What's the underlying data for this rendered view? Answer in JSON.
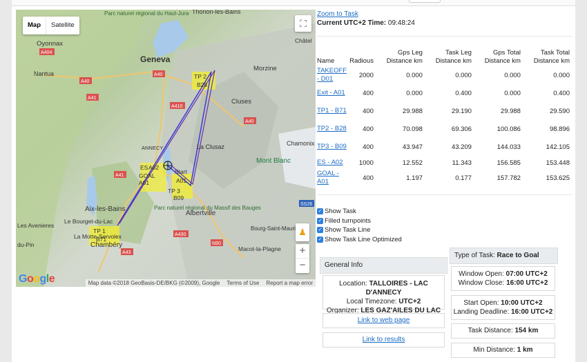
{
  "map": {
    "type_buttons": [
      "Map",
      "Satellite"
    ],
    "places": [
      {
        "name": "Geneva",
        "cls": "city"
      },
      {
        "name": "Oyonnax",
        "cls": "town"
      },
      {
        "name": "Nantua",
        "cls": "town"
      },
      {
        "name": "Morzine",
        "cls": "town"
      },
      {
        "name": "Cluses",
        "cls": "town"
      },
      {
        "name": "ANNECY",
        "cls": "small"
      },
      {
        "name": "La Clusaz",
        "cls": "town"
      },
      {
        "name": "Chamonix",
        "cls": "town"
      },
      {
        "name": "Mont Blanc",
        "cls": "mountain"
      },
      {
        "name": "Albertville",
        "cls": "town"
      },
      {
        "name": "Aix-les-Bains",
        "cls": "town"
      },
      {
        "name": "Chambéry",
        "cls": "town"
      },
      {
        "name": "Les Avenieres",
        "cls": "town"
      },
      {
        "name": "Le Bourget-du-Lac",
        "cls": "town"
      },
      {
        "name": "La Motte-Servolex",
        "cls": "town"
      },
      {
        "name": "Bourg-Saint-Maurice",
        "cls": "town"
      },
      {
        "name": "Macot-la-Plagne",
        "cls": "town"
      },
      {
        "name": "Thonon-les-Bains",
        "cls": "town"
      },
      {
        "name": "Parc naturel régional du Haut-Jura",
        "cls": "park"
      },
      {
        "name": "Parc naturel régional du Massif des Bauges",
        "cls": "park"
      },
      {
        "name": "Châtel",
        "cls": "town"
      },
      {
        "name": "du-Pin",
        "cls": "town"
      }
    ],
    "roads": [
      "A404",
      "A40",
      "A40",
      "A41",
      "A410",
      "A40",
      "A430",
      "N90",
      "A41",
      "A43",
      "SS26"
    ],
    "turnpoints": [
      {
        "label": "TP 2",
        "sub": "B28"
      },
      {
        "label": "TP 3",
        "sub": "B09"
      },
      {
        "label": "TP 1",
        "sub": "B71"
      },
      {
        "label": "ES",
        "sub": "A02"
      },
      {
        "label": "GOAL",
        "sub": "A01"
      },
      {
        "label": "Start",
        "sub": "A01"
      }
    ],
    "google_logo": "Google",
    "attribution": [
      "Map data ©2018 GeoBasis-DE/BKG (©2009), Google",
      "Terms of Use",
      "Report a map error"
    ]
  },
  "zoom_link": "Zoom to Task",
  "current_time_label": "Current UTC+2 Time:",
  "current_time": "09:48:24",
  "table": {
    "headers": [
      "Name",
      "Radious",
      "Gps Leg Distance km",
      "Task Leg Distance km",
      "Gps Total Distance km",
      "Task Total Distance km"
    ],
    "rows": [
      {
        "name": "TAKEOFF - D01",
        "radius": "2000",
        "gps_leg": "0.000",
        "task_leg": "0.000",
        "gps_total": "0.000",
        "task_total": "0.000"
      },
      {
        "name": "Exit - A01",
        "radius": "400",
        "gps_leg": "0.000",
        "task_leg": "0.400",
        "gps_total": "0.000",
        "task_total": "0.400"
      },
      {
        "name": "TP1 - B71",
        "radius": "400",
        "gps_leg": "29.988",
        "task_leg": "29.190",
        "gps_total": "29.988",
        "task_total": "29.590"
      },
      {
        "name": "TP2 - B28",
        "radius": "400",
        "gps_leg": "70.098",
        "task_leg": "69.306",
        "gps_total": "100.086",
        "task_total": "98.896"
      },
      {
        "name": "TP3 - B09",
        "radius": "400",
        "gps_leg": "43.947",
        "task_leg": "43.209",
        "gps_total": "144.033",
        "task_total": "142.105"
      },
      {
        "name": "ES - A02",
        "radius": "1000",
        "gps_leg": "12.552",
        "task_leg": "11.343",
        "gps_total": "156.585",
        "task_total": "153.448"
      },
      {
        "name": "GOAL - A01",
        "radius": "400",
        "gps_leg": "1.197",
        "task_leg": "0.177",
        "gps_total": "157.782",
        "task_total": "153.625"
      }
    ]
  },
  "options": [
    "Show Task",
    "Filled turnpoints",
    "Show Task Line",
    "Show Task Line Optimized"
  ],
  "general_info": {
    "title": "General Info",
    "location_label": "Location:",
    "location": "TALLOIRES - LAC D'ANNECY",
    "timezone_label": "Local Timezone:",
    "timezone": "UTC+2",
    "organizer_label": "Organizer:",
    "organizer": "LES GAZ'AILES DU LAC",
    "web_link": "Link to web page",
    "results_link": "Link to results"
  },
  "task_info": {
    "type_label": "Type of Task:",
    "type": "Race to Goal",
    "window_open_label": "Window Open:",
    "window_open": "07:00 UTC+2",
    "window_close_label": "Window Close:",
    "window_close": "16:00 UTC+2",
    "start_open_label": "Start Open:",
    "start_open": "10:00 UTC+2",
    "landing_deadline_label": "Landing Deadline:",
    "landing_deadline": "16:00 UTC+2",
    "task_distance_label": "Task Distance:",
    "task_distance": "154 km",
    "min_distance_label": "Min Distance:",
    "min_distance": "1 km"
  },
  "colors": {
    "link": "#1a6bc4",
    "task_line": "#3b3ad6",
    "task_line_opt": "#6a2fb0",
    "turnpoint_fill": "#f2ee2e",
    "checkbox": "#2d7fe0"
  }
}
